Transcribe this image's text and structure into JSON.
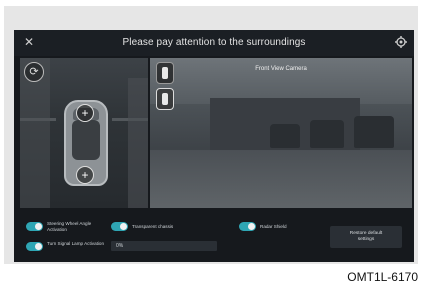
{
  "header": {
    "title": "Please pay attention to the surroundings",
    "close_icon": "close-icon",
    "settings_icon": "gear-icon"
  },
  "camera": {
    "label": "Front View Camera"
  },
  "controls": {
    "steering_wheel_label": "Steering Wheel Angle Activation",
    "steering_wheel_on": true,
    "transparent_chassis_label": "Transparent chassis",
    "transparent_chassis_on": true,
    "radar_shield_label": "Radar Shield",
    "radar_shield_on": true,
    "turn_signal_label": "Turn Signal Lamp Activation",
    "turn_signal_on": true,
    "transparency_value": "0%",
    "restore_label": "Restore default settings"
  },
  "accent_color": "#2fa6b4",
  "figure_code": "OMT1L-6170"
}
